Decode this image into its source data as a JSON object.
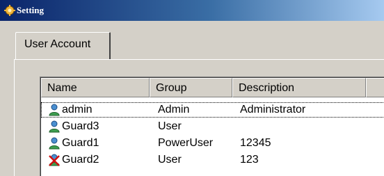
{
  "window": {
    "title": "Setting",
    "icon": "settings-gear-icon"
  },
  "tabs": [
    {
      "label": "User Account",
      "selected": true
    }
  ],
  "table": {
    "columns": [
      "Name",
      "Group",
      "Description",
      ""
    ],
    "rows": [
      {
        "name": "admin",
        "group": "Admin",
        "description": "Administrator",
        "icon": "user-icon",
        "focused": true
      },
      {
        "name": "Guard3",
        "group": "User",
        "description": "",
        "icon": "user-icon",
        "focused": false
      },
      {
        "name": "Guard1",
        "group": "PowerUser",
        "description": "12345",
        "icon": "user-icon",
        "focused": false
      },
      {
        "name": "Guard2",
        "group": "User",
        "description": "123",
        "icon": "user-disabled-icon",
        "focused": false
      }
    ]
  },
  "colors": {
    "title_bar_start": "#0a246a",
    "title_bar_end": "#a6caf0",
    "window_bg": "#d4d0c8",
    "list_bg": "#ffffff"
  }
}
